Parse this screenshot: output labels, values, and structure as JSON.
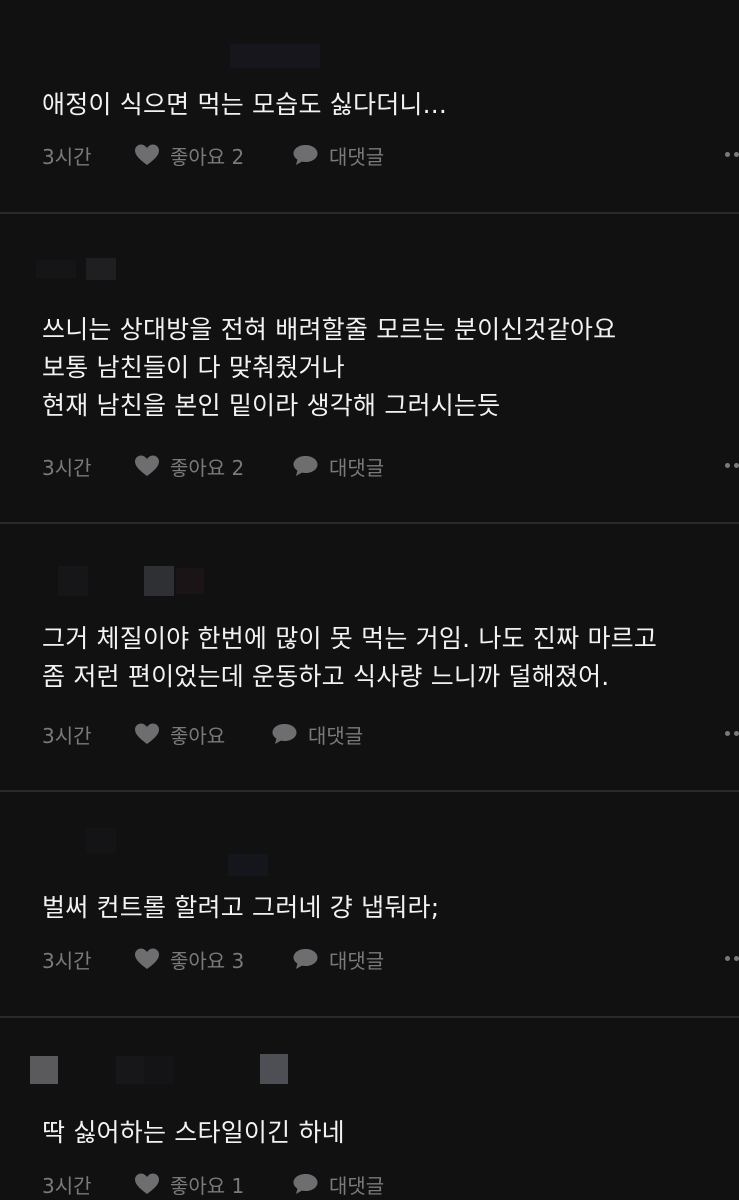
{
  "comments": [
    {
      "text": "애정이 식으면 먹는 모습도 싫다더니...",
      "time": "3시간",
      "like_label": "좋아요 2",
      "reply_label": "대댓글"
    },
    {
      "text": "쓰니는 상대방을 전혀 배려할줄 모르는 분이신것같아요\n보통 남친들이 다 맞춰줬거나\n현재 남친을 본인 밑이라 생각해 그러시는듯",
      "time": "3시간",
      "like_label": "좋아요 2",
      "reply_label": "대댓글"
    },
    {
      "text": "그거 체질이야 한번에 많이 못 먹는 거임. 나도 진짜 마르고\n좀 저런 편이었는데 운동하고 식사량 느니까 덜해졌어.",
      "time": "3시간",
      "like_label": "좋아요",
      "reply_label": "대댓글"
    },
    {
      "text": "벌써 컨트롤 할려고 그러네 걍 냅둬라;",
      "time": "3시간",
      "like_label": "좋아요 3",
      "reply_label": "대댓글"
    },
    {
      "text": "딱 싫어하는 스타일이긴 하네",
      "time": "3시간",
      "like_label": "좋아요 1",
      "reply_label": "대댓글"
    }
  ],
  "icons": {
    "like": "heart-icon",
    "reply": "speech-bubble-icon",
    "more": "more-dots-icon"
  },
  "colors": {
    "background": "#111112",
    "text": "#f2f2f2",
    "meta": "#7a7a7c",
    "divider": "#2a2a2c"
  }
}
